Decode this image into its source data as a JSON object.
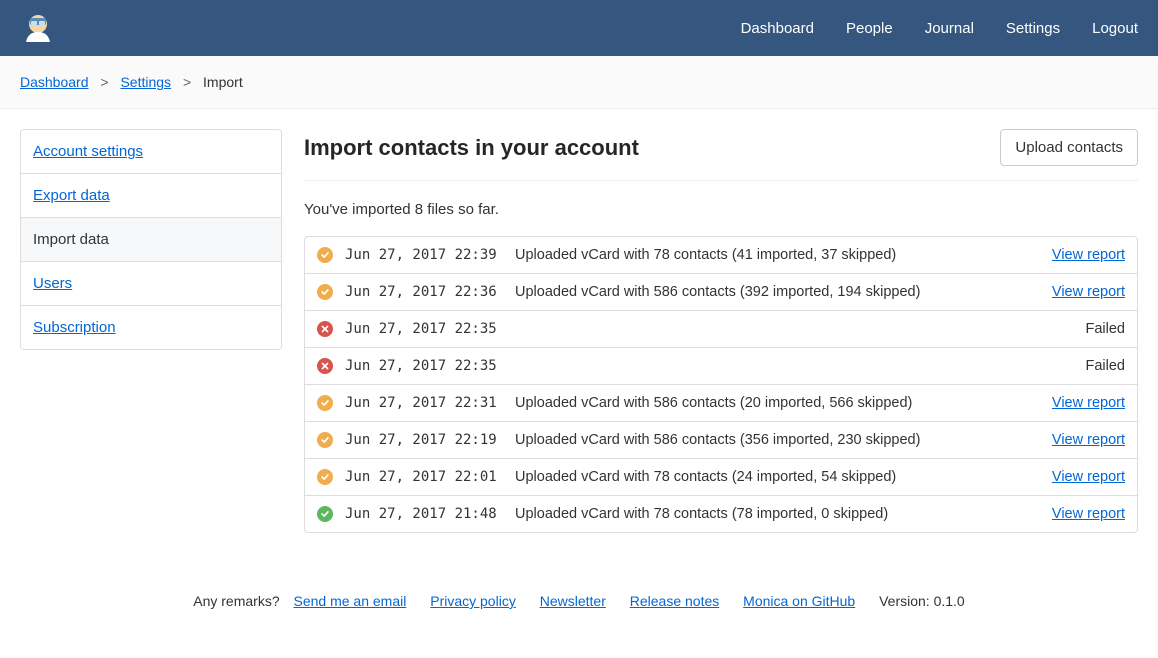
{
  "nav": {
    "dashboard": "Dashboard",
    "people": "People",
    "journal": "Journal",
    "settings": "Settings",
    "logout": "Logout"
  },
  "breadcrumb": {
    "dashboard": "Dashboard",
    "settings": "Settings",
    "current": "Import"
  },
  "sidebar": {
    "account": "Account settings",
    "export": "Export data",
    "import": "Import data",
    "users": "Users",
    "subscription": "Subscription"
  },
  "main": {
    "title": "Import contacts in your account",
    "upload_btn": "Upload contacts",
    "subtitle": "You've imported 8 files so far.",
    "view_report": "View report",
    "failed": "Failed"
  },
  "imports": [
    {
      "status": "success",
      "date": "Jun 27, 2017 22:39",
      "desc": "Uploaded vCard with 78 contacts (41 imported, 37 skipped)",
      "action": "report"
    },
    {
      "status": "success",
      "date": "Jun 27, 2017 22:36",
      "desc": "Uploaded vCard with 586 contacts (392 imported, 194 skipped)",
      "action": "report"
    },
    {
      "status": "failed",
      "date": "Jun 27, 2017 22:35",
      "desc": "",
      "action": "failed"
    },
    {
      "status": "failed",
      "date": "Jun 27, 2017 22:35",
      "desc": "",
      "action": "failed"
    },
    {
      "status": "success",
      "date": "Jun 27, 2017 22:31",
      "desc": "Uploaded vCard with 586 contacts (20 imported, 566 skipped)",
      "action": "report"
    },
    {
      "status": "success",
      "date": "Jun 27, 2017 22:19",
      "desc": "Uploaded vCard with 586 contacts (356 imported, 230 skipped)",
      "action": "report"
    },
    {
      "status": "success",
      "date": "Jun 27, 2017 22:01",
      "desc": "Uploaded vCard with 78 contacts (24 imported, 54 skipped)",
      "action": "report"
    },
    {
      "status": "complete",
      "date": "Jun 27, 2017 21:48",
      "desc": "Uploaded vCard with 78 contacts (78 imported, 0 skipped)",
      "action": "report"
    }
  ],
  "footer": {
    "remarks": "Any remarks?",
    "email": "Send me an email",
    "privacy": "Privacy policy",
    "newsletter": "Newsletter",
    "release": "Release notes",
    "github": "Monica on GitHub",
    "version": "Version: 0.1.0"
  }
}
